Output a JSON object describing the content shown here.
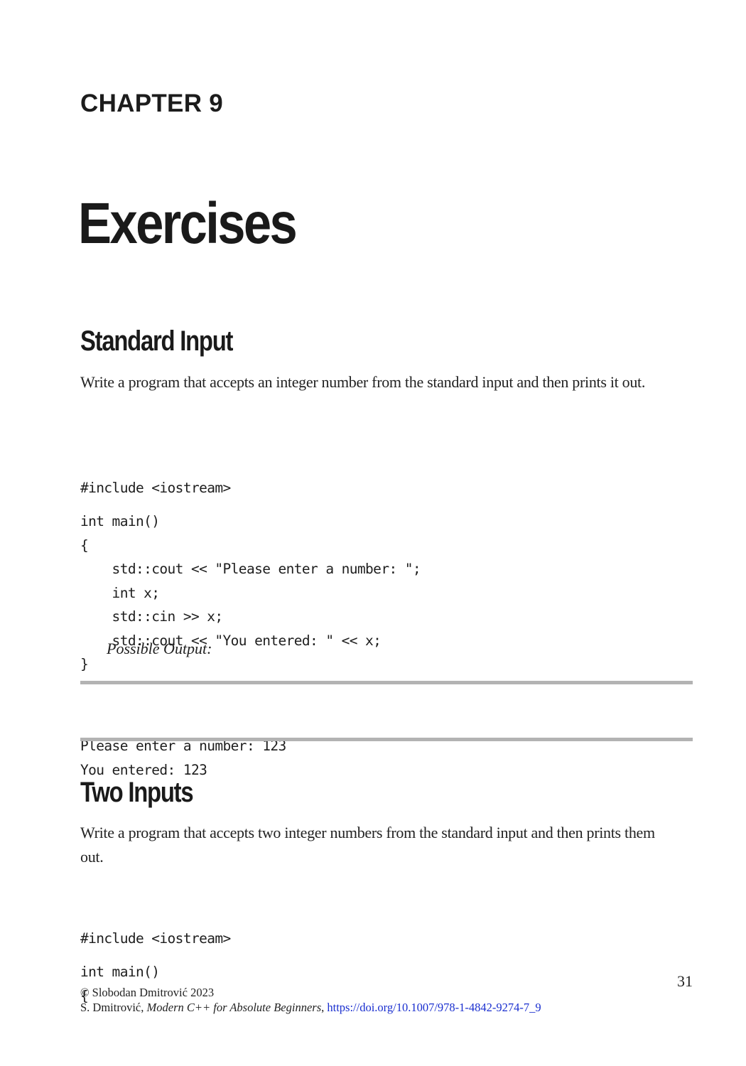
{
  "chapter": {
    "label": "CHAPTER 9",
    "title": "Exercises"
  },
  "sections": [
    {
      "heading": "Standard Input",
      "description": "Write a program that accepts an integer number from the standard input and then prints it out.",
      "code_include": "#include <iostream>",
      "code_lines": [
        "int main()",
        "{",
        "    std::cout << \"Please enter a number: \";",
        "    int x;",
        "    std::cin >> x;",
        "    std::cout << \"You entered: \" << x;",
        "}"
      ],
      "output_caption": "Possible Output:",
      "output_lines": [
        "Please enter a number: 123",
        "You entered: 123"
      ]
    },
    {
      "heading": "Two Inputs",
      "description": "Write a program that accepts two integer numbers from the standard input and then prints them out.",
      "code_include": "#include <iostream>",
      "code_lines": [
        "int main()",
        "{"
      ]
    }
  ],
  "footer": {
    "page_number": "31",
    "copyright": "© Slobodan Dmitrović 2023",
    "citation_author": "S. Dmitrović, ",
    "citation_book": "Modern C++ for Absolute Beginners",
    "citation_sep": ", ",
    "doi_link": "https://doi.org/10.1007/978-1-4842-9274-7_9",
    "link_color": "#1a2fcf"
  }
}
